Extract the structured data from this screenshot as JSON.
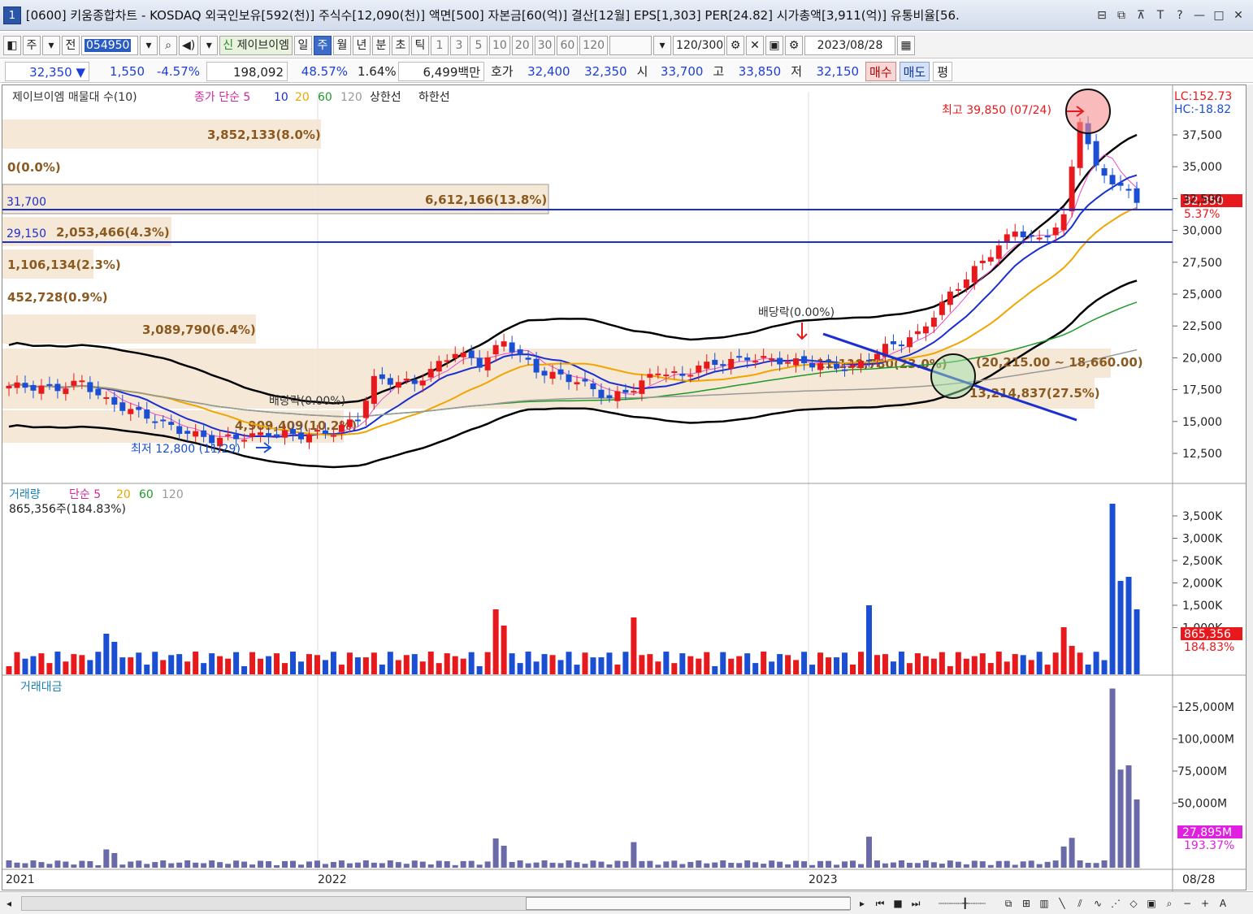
{
  "window": {
    "number": "1",
    "title": "[0600] 키움종합차트 - KOSDAQ 외국인보유[592(천)] 주식수[12,090(천)] 액면[500] 자본금[60(억)] 결산[12월] EPS[1,303] PER[24.82] 시가총액[3,911(억)] 유통비율[56.",
    "controls": [
      "⊟",
      "⧉",
      "⊼",
      "T",
      "?",
      "—",
      "□",
      "✕"
    ]
  },
  "toolbar": {
    "market": "주",
    "prev_label": "전",
    "code": "054950",
    "stock_name": "제이브이엠",
    "period_tabs": [
      "일",
      "주",
      "월",
      "년",
      "분",
      "초",
      "틱"
    ],
    "selected_period": "주",
    "interval_buttons": [
      "1",
      "3",
      "5",
      "10",
      "20",
      "30",
      "60",
      "120"
    ],
    "count": "120/300",
    "date": "2023/08/28"
  },
  "quote": {
    "price": "32,350",
    "change_arrow": "▼",
    "change": "1,550",
    "change_pct": "-4.57%",
    "volume": "198,092",
    "vol_ratio": "48.57%",
    "turnover": "1.64%",
    "amount": "6,499백만",
    "hoga_label": "호가",
    "ask": "32,400",
    "bid": "32,350",
    "open_label": "시",
    "open": "33,700",
    "high_label": "고",
    "high": "33,850",
    "low_label": "저",
    "low": "32,150",
    "buy_label": "매수",
    "sell_label": "매도",
    "eval_label": "평"
  },
  "price_panel": {
    "legend": {
      "title": "제이브이엠 매물대 수(10)",
      "ma_label": "종가 단순 5",
      "ma_periods": [
        "10",
        "20",
        "60",
        "120"
      ],
      "upper": "상한선",
      "lower": "하한선"
    },
    "lc": "LC:152.73",
    "hc": "HC:-18.82",
    "high_note": "최고 39,850 (07/24)",
    "low_note": "최저 12,800 (11/29)",
    "dividend_notes": [
      "배당락(0.00%)",
      "배당락(0.00%)"
    ],
    "current_price_tag": "32,350",
    "current_pct_tag": "5.37%",
    "hline_labels": [
      "31,700",
      "29,150"
    ],
    "volume_profile": [
      {
        "label": "3,852,133(8.0%)"
      },
      {
        "label": "0(0.0%)"
      },
      {
        "label": "6,612,166(13.8%)"
      },
      {
        "label": "2,053,466(4.3%)"
      },
      {
        "label": "1,106,134(2.3%)"
      },
      {
        "label": "452,728(0.9%)"
      },
      {
        "label": "3,089,790(6.4%)"
      },
      {
        "label": "11,119,780(23.0%)"
      },
      {
        "label": "13,214,837(27.5%)"
      },
      {
        "label": "4,909,409(10.2%)"
      }
    ],
    "range_note": "(20,215.00 ~ 18,660.00)",
    "yaxis": [
      "37,500",
      "35,000",
      "32,500",
      "30,000",
      "27,500",
      "25,000",
      "22,500",
      "20,000",
      "17,500",
      "15,000",
      "12,500"
    ]
  },
  "volume_panel": {
    "legend_title": "거래량",
    "ma_label": "단순 5",
    "ma_periods": [
      "20",
      "60",
      "120"
    ],
    "info": "865,356주(184.83%)",
    "yaxis": [
      "3,500K",
      "3,000K",
      "2,500K",
      "2,000K",
      "1,500K",
      "1,000K"
    ],
    "tag_value": "865,356",
    "tag_pct": "184.83%"
  },
  "amount_panel": {
    "legend_title": "거래대금",
    "yaxis": [
      "125,000M",
      "100,000M",
      "75,000M",
      "50,000M"
    ],
    "tag_value": "27,895M",
    "tag_pct": "193.37%"
  },
  "xaxis": {
    "labels": [
      "2021",
      "2022",
      "2023"
    ],
    "last_date": "08/28"
  },
  "colors": {
    "up": "#e8191c",
    "down": "#1a4fd4",
    "ma5": "#e64cc9",
    "ma10": "#1a2fd0",
    "ma20": "#f0a500",
    "ma60": "#1e9a2a",
    "ma120": "#999999",
    "band": "#000000",
    "profile": "#f5e6d3",
    "hline": "#1a2fd0",
    "amount": "#6a6aa8"
  }
}
